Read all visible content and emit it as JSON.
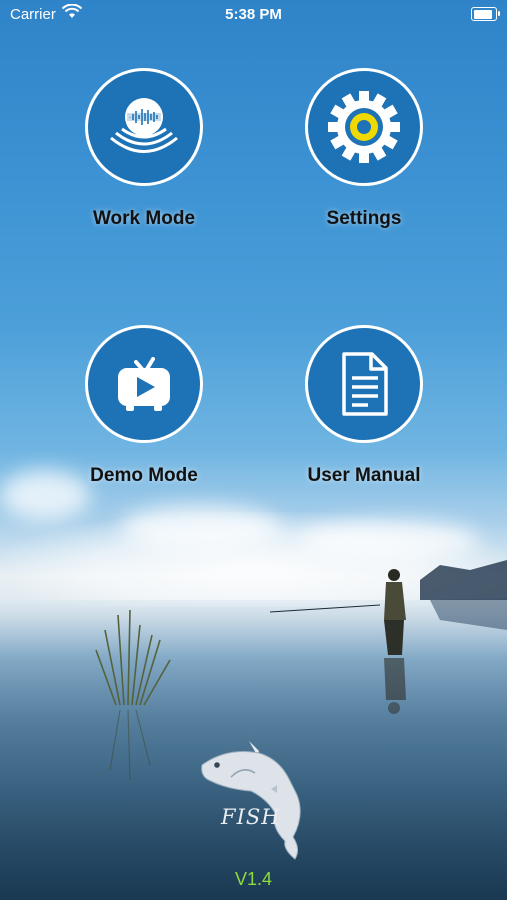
{
  "status_bar": {
    "carrier": "Carrier",
    "time": "5:38 PM",
    "battery_level": 1.0
  },
  "menu": {
    "work_mode": {
      "label": "Work Mode",
      "icon": "sonar-icon"
    },
    "settings": {
      "label": "Settings",
      "icon": "gear-icon"
    },
    "demo_mode": {
      "label": "Demo Mode",
      "icon": "tv-play-icon"
    },
    "user_manual": {
      "label": "User Manual",
      "icon": "document-icon"
    }
  },
  "logo": {
    "text": "FISH",
    "icon": "fish-logo-icon"
  },
  "version": "V1.4",
  "colors": {
    "button_fill": "#1e73b6",
    "version_text": "#8fdc3b",
    "label_text": "#111111"
  }
}
